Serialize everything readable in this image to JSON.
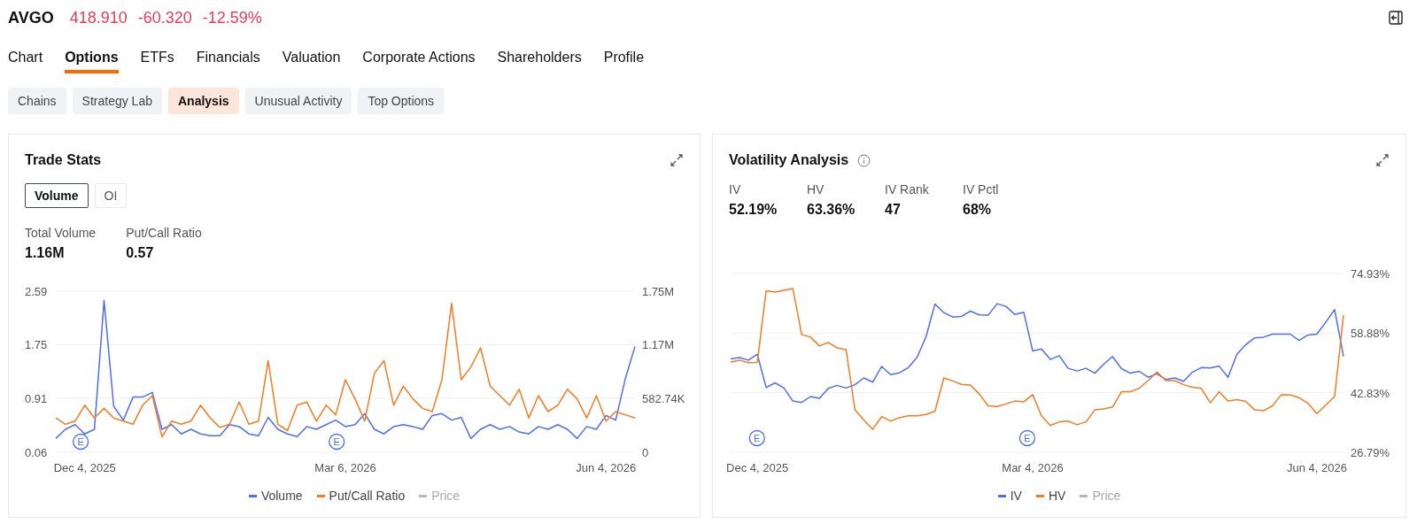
{
  "header": {
    "symbol": "AVGO",
    "price": "418.910",
    "change": "-60.320",
    "change_pct": "-12.59%"
  },
  "tabs": [
    {
      "label": "Chart",
      "selected": false
    },
    {
      "label": "Options",
      "selected": true
    },
    {
      "label": "ETFs",
      "selected": false
    },
    {
      "label": "Financials",
      "selected": false
    },
    {
      "label": "Valuation",
      "selected": false
    },
    {
      "label": "Corporate Actions",
      "selected": false
    },
    {
      "label": "Shareholders",
      "selected": false
    },
    {
      "label": "Profile",
      "selected": false
    }
  ],
  "subtabs": [
    {
      "label": "Chains",
      "selected": false
    },
    {
      "label": "Strategy Lab",
      "selected": false
    },
    {
      "label": "Analysis",
      "selected": true
    },
    {
      "label": "Unusual Activity",
      "selected": false
    },
    {
      "label": "Top Options",
      "selected": false
    }
  ],
  "trade_stats": {
    "title": "Trade Stats",
    "toggle": [
      {
        "label": "Volume",
        "selected": true
      },
      {
        "label": "OI",
        "selected": false
      }
    ],
    "stats": [
      {
        "label": "Total Volume",
        "value": "1.16M"
      },
      {
        "label": "Put/Call Ratio",
        "value": "0.57"
      }
    ],
    "chart_data": {
      "type": "line",
      "categories": [
        null,
        null,
        null,
        "Dec 4, 2025",
        null,
        null,
        null,
        null,
        null,
        null,
        null,
        null,
        null,
        null,
        null,
        null,
        null,
        null,
        null,
        null,
        null,
        null,
        null,
        null,
        null,
        null,
        null,
        null,
        null,
        null,
        "Mar 6, 2026",
        null,
        null,
        null,
        null,
        null,
        null,
        null,
        null,
        null,
        null,
        null,
        null,
        null,
        null,
        null,
        null,
        null,
        null,
        null,
        null,
        null,
        null,
        null,
        null,
        null,
        null,
        "Jun 4, 2026",
        null,
        null,
        null
      ],
      "ylim": [
        0.06,
        2.59
      ],
      "yticks": [
        2.59,
        1.75,
        0.91,
        0.06
      ],
      "y2lim": [
        0,
        1750000
      ],
      "y2ticks": [
        {
          "value": 1750000,
          "label": "1.75M"
        },
        {
          "value": 1170000,
          "label": "1.17M"
        },
        {
          "value": 582740,
          "label": "582.74K"
        },
        {
          "value": 0,
          "label": "0"
        }
      ],
      "annotations": [
        "E",
        "E"
      ],
      "series": [
        {
          "name": "Volume",
          "color": "#4d6ef5",
          "axis": "y2",
          "values": [
            150000,
            250000,
            300000,
            200000,
            250000,
            1650000,
            500000,
            350000,
            600000,
            600000,
            650000,
            250000,
            300000,
            200000,
            250000,
            200000,
            180000,
            180000,
            300000,
            280000,
            200000,
            180000,
            380000,
            250000,
            200000,
            170000,
            280000,
            250000,
            300000,
            350000,
            280000,
            300000,
            420000,
            250000,
            200000,
            280000,
            300000,
            280000,
            250000,
            400000,
            420000,
            350000,
            380000,
            150000,
            250000,
            300000,
            250000,
            280000,
            220000,
            200000,
            280000,
            250000,
            300000,
            250000,
            150000,
            280000,
            250000,
            400000,
            350000,
            800000,
            1150000
          ]
        },
        {
          "name": "Put/Call Ratio",
          "color": "#f57c23",
          "values": [
            0.6,
            0.5,
            0.55,
            0.8,
            0.6,
            0.75,
            0.6,
            0.55,
            0.5,
            0.8,
            0.95,
            0.3,
            0.55,
            0.5,
            0.55,
            0.8,
            0.6,
            0.45,
            0.5,
            0.85,
            0.5,
            0.55,
            1.5,
            0.5,
            0.4,
            0.8,
            0.85,
            0.55,
            0.8,
            0.65,
            1.2,
            0.9,
            0.55,
            1.3,
            1.5,
            0.8,
            1.1,
            0.9,
            0.75,
            0.7,
            1.2,
            2.4,
            1.2,
            1.4,
            1.7,
            1.1,
            0.95,
            0.8,
            1.05,
            0.6,
            0.95,
            0.7,
            0.8,
            1.05,
            0.9,
            0.6,
            0.95,
            0.55,
            0.7,
            0.65,
            0.6
          ]
        }
      ]
    },
    "legend_extra": [
      {
        "label": "Price",
        "color": "#b5b9c2",
        "disabled": true
      }
    ]
  },
  "volatility": {
    "title": "Volatility Analysis",
    "stats": [
      {
        "label": "IV",
        "value": "52.19%"
      },
      {
        "label": "HV",
        "value": "63.36%"
      },
      {
        "label": "IV Rank",
        "value": "47"
      },
      {
        "label": "IV Pctl",
        "value": "68%"
      }
    ],
    "chart_data": {
      "type": "line",
      "categories": [
        null,
        null,
        null,
        "Dec 4, 2025",
        null,
        null,
        null,
        null,
        null,
        null,
        null,
        null,
        null,
        null,
        null,
        null,
        null,
        null,
        null,
        null,
        null,
        null,
        null,
        null,
        null,
        null,
        null,
        null,
        null,
        null,
        null,
        null,
        null,
        null,
        "Mar 4, 2026",
        null,
        null,
        null,
        null,
        null,
        null,
        null,
        null,
        null,
        null,
        null,
        null,
        null,
        null,
        null,
        null,
        null,
        null,
        null,
        null,
        null,
        null,
        null,
        null,
        null,
        null,
        null,
        null,
        null,
        null,
        null,
        "Jun 4, 2026",
        null,
        null,
        null
      ],
      "ylim": [
        26.79,
        74.93
      ],
      "yticks": [
        {
          "value": 74.93,
          "label": "74.93%"
        },
        {
          "value": 58.88,
          "label": "58.88%"
        },
        {
          "value": 42.83,
          "label": "42.83%"
        },
        {
          "value": 26.79,
          "label": "26.79%"
        }
      ],
      "annotations": [
        "E",
        "E"
      ],
      "series": [
        {
          "name": "IV",
          "color": "#4d6ef5",
          "values": [
            51.9,
            52.3,
            51.6,
            53.2,
            44.2,
            45.5,
            44.1,
            40.6,
            40.2,
            41.8,
            41.3,
            44.0,
            44.8,
            44.1,
            45.0,
            46.8,
            45.7,
            49.9,
            47.7,
            48.2,
            49.6,
            52.4,
            57.9,
            66.7,
            64.4,
            63.2,
            63.4,
            64.8,
            63.8,
            63.7,
            66.8,
            66.1,
            63.9,
            64.5,
            54.1,
            54.6,
            51.8,
            52.8,
            49.4,
            48.7,
            49.4,
            48.1,
            50.5,
            52.6,
            49.3,
            48.1,
            48.6,
            47.0,
            47.9,
            46.4,
            46.8,
            45.9,
            48.4,
            49.6,
            49.5,
            50.0,
            47.0,
            53.2,
            55.8,
            57.6,
            57.8,
            58.6,
            58.6,
            58.6,
            56.9,
            58.4,
            58.6,
            61.8,
            65.2,
            52.6
          ]
        },
        {
          "name": "HV",
          "color": "#f57c23",
          "values": [
            51.1,
            51.6,
            50.9,
            51.0,
            70.3,
            69.9,
            70.4,
            70.9,
            58.5,
            57.8,
            55.4,
            56.4,
            54.9,
            54.4,
            38.2,
            35.5,
            33.0,
            36.4,
            35.2,
            36.1,
            36.6,
            36.6,
            37.0,
            37.8,
            46.8,
            46.0,
            45.1,
            44.9,
            42.5,
            39.3,
            39.1,
            39.8,
            40.6,
            40.4,
            42.3,
            36.6,
            34.0,
            35.0,
            35.2,
            34.2,
            35.0,
            38.2,
            38.5,
            39.0,
            43.1,
            43.1,
            44.0,
            46.1,
            48.4,
            46.1,
            46.1,
            45.0,
            44.3,
            44.0,
            40.1,
            43.1,
            40.6,
            41.0,
            40.5,
            38.2,
            38.0,
            39.3,
            42.3,
            42.2,
            41.5,
            40.0,
            37.2,
            39.5,
            41.8,
            63.7
          ]
        }
      ]
    },
    "legend_extra": [
      {
        "label": "Price",
        "color": "#b5b9c2",
        "disabled": true
      }
    ]
  }
}
